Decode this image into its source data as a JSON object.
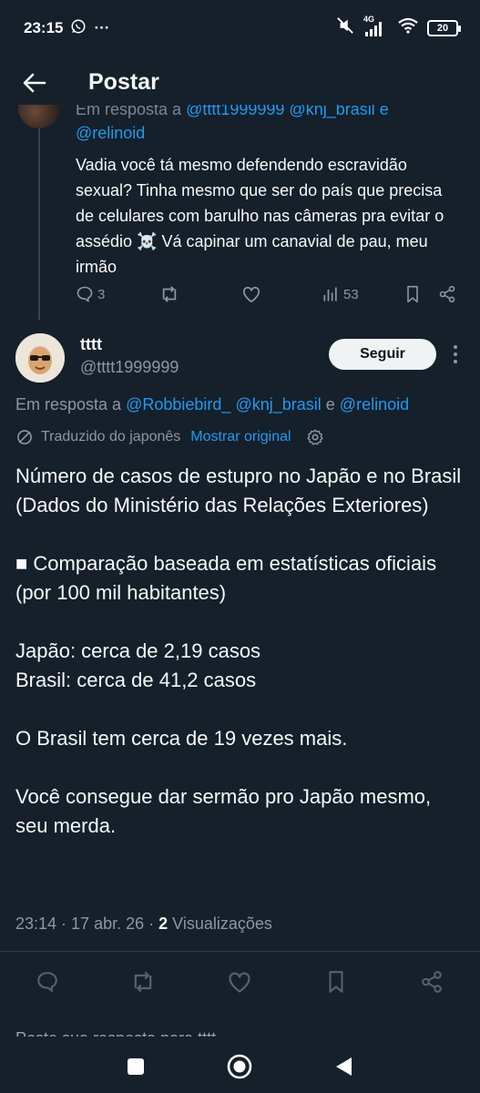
{
  "status_bar": {
    "time": "23:15",
    "more": "···",
    "network": "4G",
    "battery": "20"
  },
  "header": {
    "title": "Postar"
  },
  "parent_tweet": {
    "reply_prefix": "Em resposta a",
    "reply_handles_line1": "@tttt1999999 @knj_brasil e",
    "reply_handle_line2": "@relinoid",
    "text": "Vadia você tá mesmo defendendo escravidão sexual? Tinha mesmo que ser do país que precisa de celulares com barulho nas câmeras pra evitar o assédio ☠️ Vá capinar um canavial de pau, meu irmão",
    "reply_count": "3",
    "views_count": "53"
  },
  "tweet": {
    "author_name": "tttt",
    "author_handle": "@tttt1999999",
    "follow_label": "Seguir",
    "reply_prefix": "Em resposta a",
    "reply_handle_1": "@Robbiebird_",
    "reply_handle_2": "@knj_brasil",
    "reply_and": "e",
    "reply_handle_3": "@relinoid",
    "translated_label": "Traduzido do japonês",
    "show_original_label": "Mostrar original",
    "body": {
      "line_1": "Número de casos de estupro no Japão e no Brasil",
      "line_2": "(Dados do Ministério das Relações Exteriores)",
      "line_3": "■ Comparação baseada em estatísticas oficiais (por 100 mil habitantes)",
      "line_4": "Japão: cerca de 2,19 casos",
      "line_5": "Brasil: cerca de 41,2 casos",
      "line_6": "O Brasil tem cerca de 19 vezes mais.",
      "line_7": "Você consegue dar sermão pro Japão mesmo, seu merda."
    },
    "time": "23:14",
    "date": "17 abr. 26",
    "views_count": "2",
    "views_label": "Visualizações"
  },
  "truncated_next_line": "Poste sua resposta para tttt"
}
